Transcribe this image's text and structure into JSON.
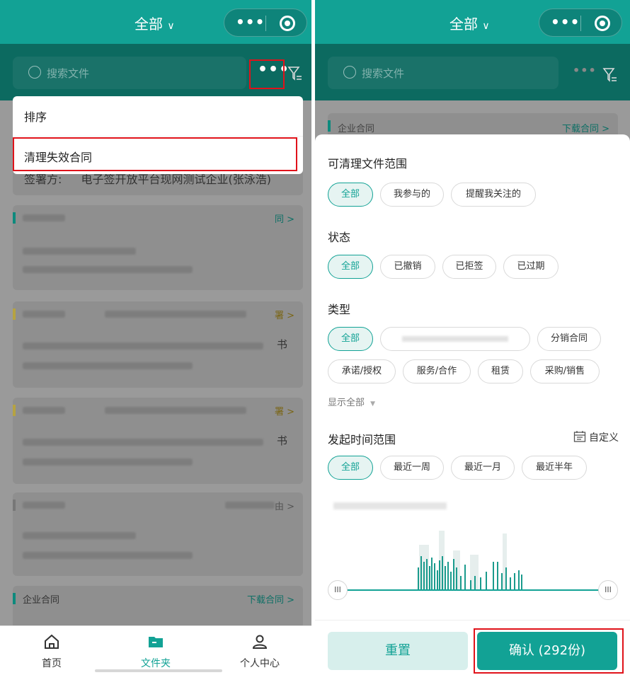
{
  "left": {
    "header": {
      "title": "全部"
    },
    "search": {
      "placeholder": "搜索文件"
    },
    "menu": {
      "items": [
        "排序",
        "清理失效合同"
      ]
    },
    "card_partial": {
      "signer_label": "签署方:",
      "signer_value": "电子签开放平台现网测试企业(张泳浩)"
    },
    "cards": [
      {
        "tag": "",
        "action": "同 >"
      },
      {
        "tag": "",
        "action": "署 >",
        "tail": "书"
      },
      {
        "tag": "",
        "action": "署 >",
        "tail": "书"
      },
      {
        "tag": "",
        "action": "由 >"
      },
      {
        "tag": "企业合同",
        "action": "下载合同 >"
      }
    ],
    "tabbar": {
      "items": [
        {
          "label": "首页",
          "icon": "home-icon"
        },
        {
          "label": "文件夹",
          "icon": "folder-icon"
        },
        {
          "label": "个人中心",
          "icon": "user-icon"
        }
      ]
    }
  },
  "right": {
    "header": {
      "title": "全部"
    },
    "search": {
      "placeholder": "搜索文件"
    },
    "peek": {
      "tag": "企业合同",
      "action": "下载合同 >"
    },
    "sheet": {
      "scope": {
        "title": "可清理文件范围",
        "options": [
          "全部",
          "我参与的",
          "提醒我关注的"
        ],
        "selected": "全部"
      },
      "status": {
        "title": "状态",
        "options": [
          "全部",
          "已撤销",
          "已拒签",
          "已过期"
        ],
        "selected": "全部"
      },
      "type": {
        "title": "类型",
        "options": [
          "全部",
          "",
          "分销合同",
          "承诺/授权",
          "服务/合作",
          "租赁",
          "采购/销售"
        ],
        "selected": "全部",
        "show_all": "显示全部"
      },
      "time": {
        "title": "发起时间范围",
        "custom_label": "自定义",
        "options": [
          "全部",
          "最近一周",
          "最近一月",
          "最近半年"
        ],
        "selected": "全部"
      },
      "slider": {
        "handle_left": "III",
        "handle_right": "III"
      },
      "buttons": {
        "reset": "重置",
        "confirm": "确认 (292份)"
      }
    }
  },
  "colors": {
    "accent": "#12a295",
    "dark_accent": "#0c6a60",
    "highlight": "#e0121a"
  }
}
